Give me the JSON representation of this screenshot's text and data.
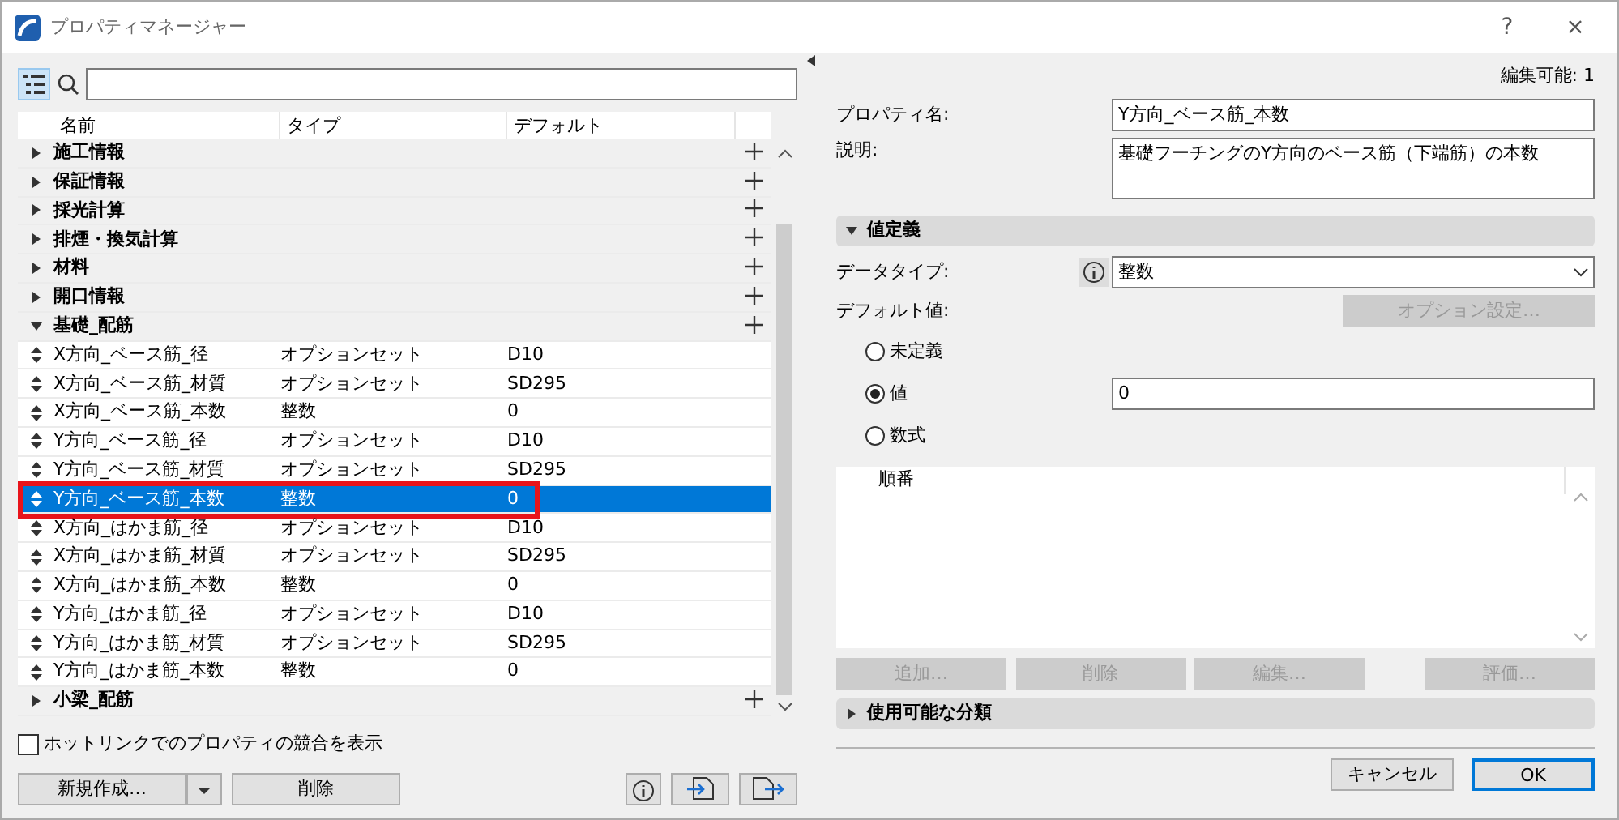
{
  "window": {
    "title": "プロパティマネージャー",
    "help": "?",
    "close": "×"
  },
  "left": {
    "columns": [
      "名前",
      "タイプ",
      "デフォルト"
    ],
    "groups": [
      {
        "label": "施工情報",
        "expanded": false
      },
      {
        "label": "保証情報",
        "expanded": false
      },
      {
        "label": "採光計算",
        "expanded": false
      },
      {
        "label": "排煙・換気計算",
        "expanded": false
      },
      {
        "label": "材料",
        "expanded": false
      },
      {
        "label": "開口情報",
        "expanded": false
      },
      {
        "label": "基礎_配筋",
        "expanded": true,
        "children": [
          {
            "name": "X方向_ベース筋_径",
            "type": "オプションセット",
            "default": "D10",
            "selected": false,
            "highlighted": false
          },
          {
            "name": "X方向_ベース筋_材質",
            "type": "オプションセット",
            "default": "SD295",
            "selected": false,
            "highlighted": false
          },
          {
            "name": "X方向_ベース筋_本数",
            "type": "整数",
            "default": "0",
            "selected": false,
            "highlighted": false
          },
          {
            "name": "Y方向_ベース筋_径",
            "type": "オプションセット",
            "default": "D10",
            "selected": false,
            "highlighted": false
          },
          {
            "name": "Y方向_ベース筋_材質",
            "type": "オプションセット",
            "default": "SD295",
            "selected": false,
            "highlighted": false
          },
          {
            "name": "Y方向_ベース筋_本数",
            "type": "整数",
            "default": "0",
            "selected": true,
            "highlighted": true
          },
          {
            "name": "X方向_はかま筋_径",
            "type": "オプションセット",
            "default": "D10",
            "selected": false,
            "highlighted": false
          },
          {
            "name": "X方向_はかま筋_材質",
            "type": "オプションセット",
            "default": "SD295",
            "selected": false,
            "highlighted": false
          },
          {
            "name": "X方向_はかま筋_本数",
            "type": "整数",
            "default": "0",
            "selected": false,
            "highlighted": false
          },
          {
            "name": "Y方向_はかま筋_径",
            "type": "オプションセット",
            "default": "D10",
            "selected": false,
            "highlighted": false
          },
          {
            "name": "Y方向_はかま筋_材質",
            "type": "オプションセット",
            "default": "SD295",
            "selected": false,
            "highlighted": false
          },
          {
            "name": "Y方向_はかま筋_本数",
            "type": "整数",
            "default": "0",
            "selected": false,
            "highlighted": false
          }
        ]
      },
      {
        "label": "小梁_配筋",
        "expanded": false
      }
    ],
    "hotlink_checkbox": {
      "label": "ホットリンクでのプロパティの競合を表示",
      "checked": false
    },
    "new_button": "新規作成…",
    "delete_button": "削除"
  },
  "right": {
    "editable": "編集可能: 1",
    "property_name": {
      "label": "プロパティ名:",
      "value": "Y方向_ベース筋_本数"
    },
    "description": {
      "label": "説明:",
      "value": "基礎フーチングのY方向のベース筋（下端筋）の本数"
    },
    "value_section": {
      "label": "値定義",
      "expanded": true
    },
    "data_type": {
      "label": "データタイプ:",
      "value": "整数"
    },
    "default_label": "デフォルト値:",
    "option_button": {
      "label": "オプション設定…",
      "disabled": true
    },
    "radios": [
      {
        "label": "未定義",
        "selected": false
      },
      {
        "label": "値",
        "selected": true
      },
      {
        "label": "数式",
        "selected": false
      }
    ],
    "value_field": "0",
    "order_header": "順番",
    "list_buttons": [
      {
        "label": "追加…",
        "disabled": true
      },
      {
        "label": "削除",
        "disabled": true
      },
      {
        "label": "編集…",
        "disabled": true
      },
      {
        "label": "評価…",
        "disabled": true
      }
    ],
    "classification_section": {
      "label": "使用可能な分類",
      "expanded": false
    },
    "cancel_button": "キャンセル",
    "ok_button": "OK"
  }
}
